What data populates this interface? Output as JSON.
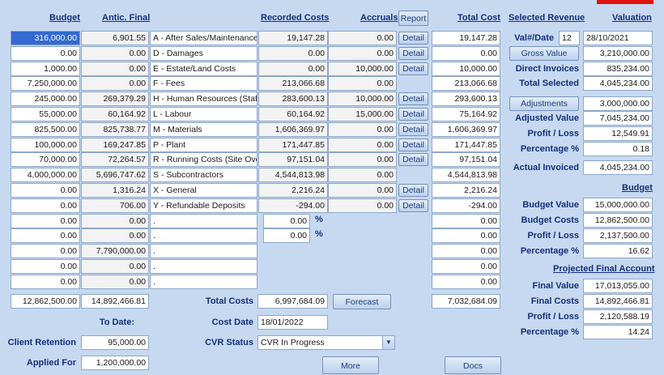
{
  "headers": {
    "budget": "Budget",
    "antic_final": "Antic. Final",
    "recorded_costs": "Recorded Costs",
    "accruals": "Accruals",
    "report": "Report",
    "total_cost": "Total Cost",
    "selected_revenue": "Selected Revenue",
    "valuation": "Valuation"
  },
  "rows": [
    {
      "budget": "316,000.00",
      "antic": "6,901.55",
      "code": "A - After Sales/Maintenance",
      "recorded": "19,147.28",
      "accrual": "0.00",
      "detail": "Detail",
      "total": "19,147.28"
    },
    {
      "budget": "0.00",
      "antic": "0.00",
      "code": "D - Damages",
      "recorded": "0.00",
      "accrual": "0.00",
      "detail": "Detail",
      "total": "0.00"
    },
    {
      "budget": "1,000.00",
      "antic": "0.00",
      "code": "E - Estate/Land Costs",
      "recorded": "0.00",
      "accrual": "10,000.00",
      "detail": "Detail",
      "total": "10,000.00"
    },
    {
      "budget": "7,250,000.00",
      "antic": "0.00",
      "code": "F - Fees",
      "recorded": "213,066.68",
      "accrual": "0.00",
      "detail": "",
      "total": "213,066.68"
    },
    {
      "budget": "245,000.00",
      "antic": "269,379.29",
      "code": "H - Human Resources (Staff)",
      "recorded": "283,600.13",
      "accrual": "10,000.00",
      "detail": "Detail",
      "total": "293,600.13"
    },
    {
      "budget": "55,000.00",
      "antic": "60,164.92",
      "code": "L - Labour",
      "recorded": "60,164.92",
      "accrual": "15,000.00",
      "detail": "Detail",
      "total": "75,164.92"
    },
    {
      "budget": "825,500.00",
      "antic": "825,738.77",
      "code": "M - Materials",
      "recorded": "1,606,369.97",
      "accrual": "0.00",
      "detail": "Detail",
      "total": "1,606,369.97"
    },
    {
      "budget": "100,000.00",
      "antic": "169,247.85",
      "code": "P - Plant",
      "recorded": "171,447.85",
      "accrual": "0.00",
      "detail": "Detail",
      "total": "171,447.85"
    },
    {
      "budget": "70,000.00",
      "antic": "72,264.57",
      "code": "R - Running Costs (Site Overl",
      "recorded": "97,151.04",
      "accrual": "0.00",
      "detail": "Detail",
      "total": "97,151.04"
    },
    {
      "budget": "4,000,000.00",
      "antic": "5,696,747.62",
      "code": "S - Subcontractors",
      "recorded": "4,544,813.98",
      "accrual": "0.00",
      "detail": "",
      "total": "4,544,813.98"
    },
    {
      "budget": "0.00",
      "antic": "1,316.24",
      "code": "X - General",
      "recorded": "2,216.24",
      "accrual": "0.00",
      "detail": "Detail",
      "total": "2,216.24"
    },
    {
      "budget": "0.00",
      "antic": "706.00",
      "code": "Y - Refundable Deposits",
      "recorded": "-294.00",
      "accrual": "0.00",
      "detail": "Detail",
      "total": "-294.00"
    }
  ],
  "extra_rows": [
    {
      "budget": "0.00",
      "antic": "0.00",
      "code": ".",
      "pct": "0.00",
      "pct_sign": "%",
      "total": "0.00"
    },
    {
      "budget": "0.00",
      "antic": "0.00",
      "code": ".",
      "pct": "0.00",
      "pct_sign": "%",
      "total": "0.00"
    },
    {
      "budget": "0.00",
      "antic": "7,790,000.00",
      "code": ".",
      "total": "0.00"
    },
    {
      "budget": "0.00",
      "antic": "0.00",
      "code": ".",
      "total": "0.00"
    },
    {
      "budget": "0.00",
      "antic": "0.00",
      "code": ".",
      "total": "0.00"
    }
  ],
  "totals": {
    "budget": "12,862,500.00",
    "antic": "14,892,466.81",
    "total_costs_label": "Total Costs",
    "total_costs": "6,997,684.09",
    "forecast": "Forecast",
    "total_cost": "7,032,684.09"
  },
  "bottom": {
    "to_date": "To Date:",
    "cost_date_label": "Cost Date",
    "cost_date": "18/01/2022",
    "client_retention_label": "Client Retention",
    "client_retention": "95,000.00",
    "cvr_status_label": "CVR Status",
    "cvr_status": "CVR In Progress",
    "applied_for_label": "Applied For",
    "applied_for": "1,200,000.00",
    "more": "More",
    "docs": "Docs"
  },
  "right": {
    "val_date_label": "Val#/Date",
    "val_num": "12",
    "val_date": "28/10/2021",
    "gross_value": "Gross Value",
    "gross_value_amount": "3,210,000.00",
    "direct_invoices_label": "Direct Invoices",
    "direct_invoices": "835,234.00",
    "total_selected_label": "Total Selected",
    "total_selected": "4,045,234.00",
    "adjustments": "Adjustments",
    "adjustments_amount": "3,000,000.00",
    "adjusted_value_label": "Adjusted Value",
    "adjusted_value": "7,045,234.00",
    "profit_loss_label": "Profit / Loss",
    "profit_loss": "12,549.91",
    "percentage_label": "Percentage %",
    "percentage": "0.18",
    "actual_invoiced_label": "Actual Invoiced",
    "actual_invoiced": "4,045,234.00",
    "budget_hdr": "Budget",
    "budget_value_label": "Budget Value",
    "budget_value": "15,000,000.00",
    "budget_costs_label": "Budget Costs",
    "budget_costs": "12,862,500.00",
    "budget_profit_label": "Profit / Loss",
    "budget_profit": "2,137,500.00",
    "budget_pct_label": "Percentage %",
    "budget_pct": "16.62",
    "projected_hdr": "Projected Final Account",
    "final_value_label": "Final Value",
    "final_value": "17,013,055.00",
    "final_costs_label": "Final Costs",
    "final_costs": "14,892,466.81",
    "proj_profit_label": "Profit / Loss",
    "proj_profit": "2,120,588.19",
    "proj_pct_label": "Percentage %",
    "proj_pct": "14.24"
  },
  "colors": {
    "accent": "#15307a",
    "alert": "#e0140e"
  }
}
